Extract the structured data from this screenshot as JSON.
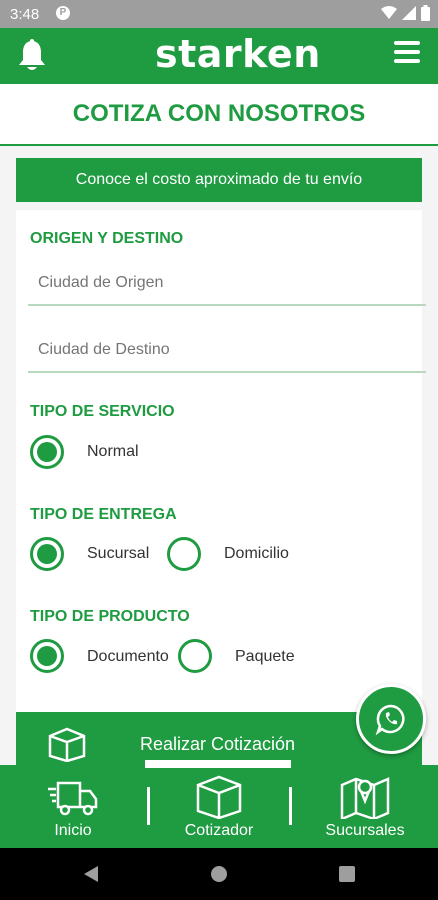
{
  "status_bar": {
    "time": "3:48",
    "notif_icon": "p-icon"
  },
  "header": {
    "logo_text": "starken",
    "left_icon": "bell-icon",
    "right_icon": "menu-icon"
  },
  "page": {
    "title": "COTIZA CON NOSOTROS",
    "banner": "Conoce el costo aproximado de tu envío"
  },
  "form": {
    "origin_dest_label": "ORIGEN Y DESTINO",
    "origin_placeholder": "Ciudad de Origen",
    "dest_placeholder": "Ciudad de Destino",
    "service_label": "TIPO DE SERVICIO",
    "service_options": [
      "Normal"
    ],
    "service_selected": "Normal",
    "delivery_label": "TIPO DE ENTREGA",
    "delivery_options": [
      "Sucursal",
      "Domicilio"
    ],
    "delivery_selected": "Sucursal",
    "product_label": "TIPO DE PRODUCTO",
    "product_options": [
      "Documento",
      "Paquete"
    ],
    "product_selected": "Documento",
    "submit_label": "Realizar Cotización"
  },
  "bottom_nav": {
    "items": [
      {
        "label": "Inicio",
        "icon": "truck-icon"
      },
      {
        "label": "Cotizador",
        "icon": "box-icon"
      },
      {
        "label": "Sucursales",
        "icon": "map-icon"
      }
    ]
  },
  "colors": {
    "brand": "#1f9b41",
    "background": "#f4f4f4"
  }
}
